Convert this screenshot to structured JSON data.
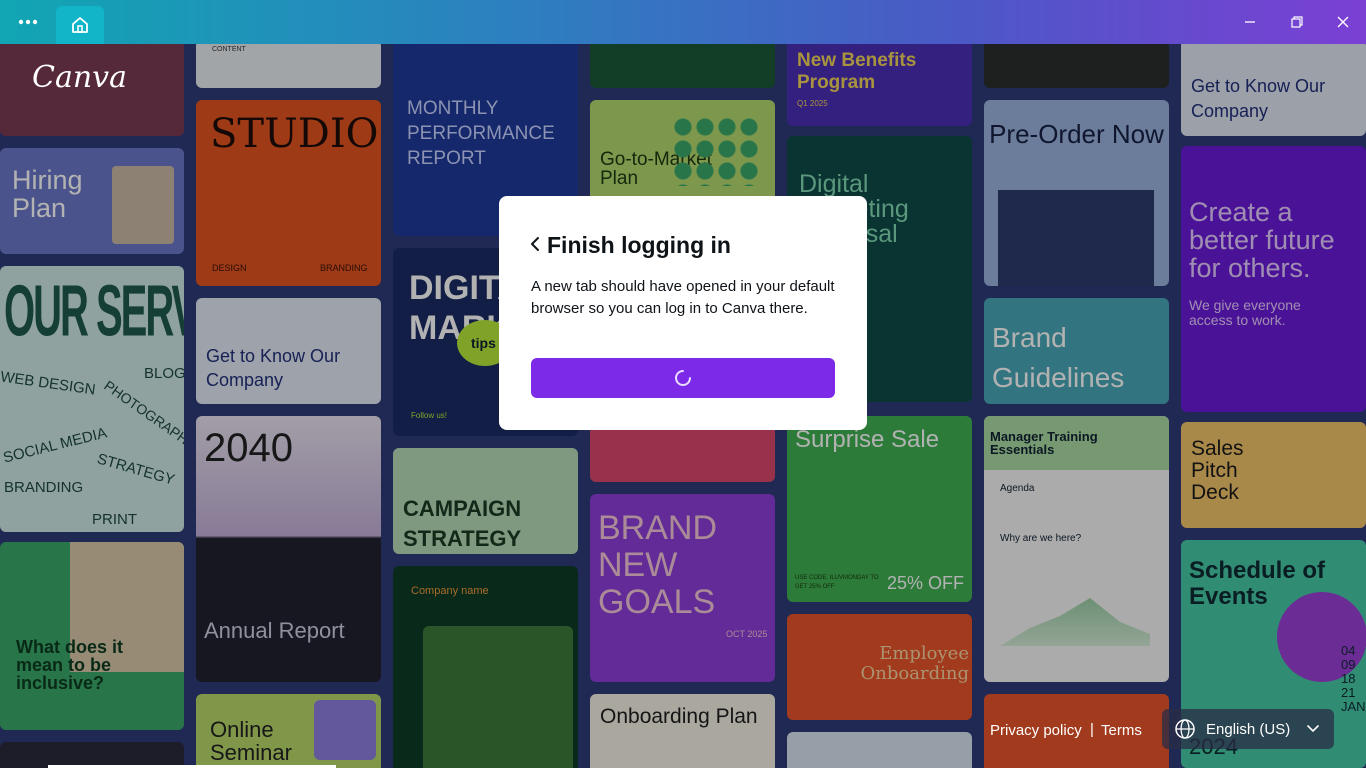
{
  "window": {
    "menu_icon": "more-horizontal-icon",
    "home_icon": "home-icon",
    "controls": [
      "minimize-icon",
      "restore-icon",
      "close-icon"
    ]
  },
  "brand": {
    "logo": "Canva"
  },
  "dialog": {
    "title": "Finish logging in",
    "message": "A new tab should have opened in your default browser so you can log in to Canva there.",
    "button_state": "loading-spinner",
    "accent": "#7d2ae8"
  },
  "footer": {
    "privacy": "Privacy policy",
    "separator": "|",
    "terms": "Terms",
    "language": "English (US)"
  },
  "templates": {
    "t01": "CONTENT",
    "t02": "STUDIO",
    "t03": "DESIGN",
    "t04": "BRANDING",
    "t05": "MONTHLY PERFORMANCE REPORT",
    "t06": "Go-to-Market Plan",
    "t07": "New Benefits Program",
    "t08": "Q1 2025",
    "t09": "Digital Marketing Proposal",
    "t10": "Pre-Order Now",
    "t11": "Get to Know Our Company",
    "t12": "Create a better future for others.",
    "t13": "We give everyone access to work.",
    "t14": "Hiring Plan",
    "t15": "OUR SERVICES",
    "t16": "WEB DESIGN",
    "t17": "BLOG",
    "t18": "PHOTOGRAPHY",
    "t19": "SOCIAL MEDIA",
    "t20": "STRATEGY",
    "t21": "BRANDING",
    "t22": "PRINT",
    "t23": "Get to Know Our Company",
    "t24": "2040",
    "t25": "Annual Report",
    "t26": "DIGITAL MARKETING",
    "t27": "tips",
    "t28": "Follow us!",
    "t29": "CAMPAIGN STRATEGY",
    "t30": "Company name",
    "t31": "BRAND NEW GOALS",
    "t32": "OCT 2025",
    "t33": "Onboarding Plan",
    "t34": "Surprise Sale",
    "t35": "USE CODE: ILUVMONDAY TO GET 25% OFF",
    "t36": "25% OFF",
    "t37": "Employee Onboarding",
    "t38": "Brand Guidelines",
    "t39": "Manager Training Essentials",
    "t40": "Agenda",
    "t41": "Why are we here?",
    "t42": "Sales Pitch Deck",
    "t43": "Schedule of Events",
    "t44": "2024",
    "t45": "04 09 18 21 JAN",
    "t46": "What does it mean to be inclusive?",
    "t47": "Online Seminar"
  }
}
